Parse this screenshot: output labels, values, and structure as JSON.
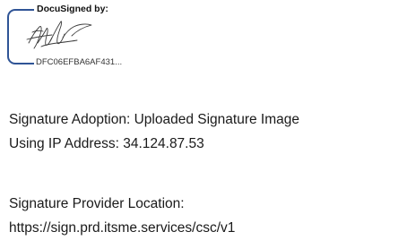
{
  "signature_block": {
    "header": "DocuSigned by:",
    "envelope_id": "DFC06EFBA6AF431..."
  },
  "details": {
    "adoption": "Signature Adoption: Uploaded Signature Image",
    "ip_address": "Using IP Address: 34.124.87.53",
    "provider_label": "Signature Provider Location:",
    "provider_url": "https://sign.prd.itsme.services/csc/v1"
  },
  "colors": {
    "bracket": "#2f5496",
    "text": "#1a1a1a"
  }
}
